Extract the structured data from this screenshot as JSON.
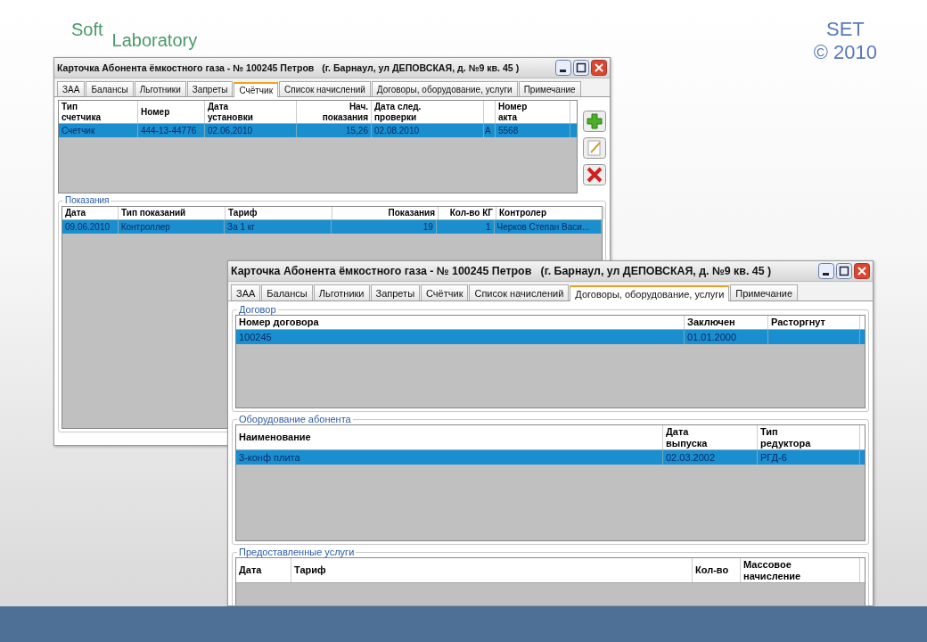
{
  "slide": {
    "brand": [
      "Soft",
      "Laboratory"
    ],
    "corner": [
      "SET",
      "© 2010"
    ]
  },
  "windows": [
    {
      "title": "Карточка Абонента ёмкостного газа - № 100245 Петров   (г. Барнаул, ул ДЕПОВСКАЯ, д. №9 кв. 45 )",
      "tabs": [
        {
          "label": "ЗАА",
          "selected": false
        },
        {
          "label": "Балансы",
          "selected": false
        },
        {
          "label": "Льготники",
          "selected": false
        },
        {
          "label": "Запреты",
          "selected": false
        },
        {
          "label": "Счётчик",
          "selected": true
        },
        {
          "label": "Список начислений",
          "selected": false
        },
        {
          "label": "Договоры, оборудование, услуги",
          "selected": false
        },
        {
          "label": "Примечание",
          "selected": false
        }
      ],
      "groups": [
        {
          "columns": [
            {
              "label": "Тип\nсчетчика",
              "kind": "text"
            },
            {
              "label": "Номер",
              "kind": "text"
            },
            {
              "label": "Дата\nустановки",
              "kind": "text"
            },
            {
              "label": "Нач.\nпоказания",
              "kind": "number"
            },
            {
              "label": "Дата след.\nпроверки",
              "kind": "text"
            },
            {
              "kind": "text"
            },
            {
              "label": "Номер\nакта",
              "kind": "text"
            }
          ],
          "rows": [
            {
              "selected": true,
              "cells": [
                "Счетчик",
                "444-13-44776",
                "02.06.2010",
                "15,26",
                "02.08.2010",
                "А",
                "5568"
              ]
            }
          ],
          "side_buttons": [
            {
              "kind": "add"
            },
            {
              "kind": "edit"
            },
            {
              "kind": "delete"
            }
          ]
        },
        {
          "legend": "Показания",
          "columns": [
            {
              "label": "Дата",
              "kind": "text"
            },
            {
              "label": "Тип показаний",
              "kind": "text"
            },
            {
              "label": "Тариф",
              "kind": "text"
            },
            {
              "label": "Показания",
              "kind": "number"
            },
            {
              "label": "Кол-во КГ",
              "kind": "number"
            },
            {
              "label": "Контролер",
              "kind": "text"
            }
          ],
          "rows": [
            {
              "selected": true,
              "cells": [
                "09.06.2010",
                "Контроллер",
                "За 1 кг",
                "19",
                "1",
                "Черков Степан Васи..."
              ]
            }
          ]
        }
      ]
    },
    {
      "title": "Карточка Абонента ёмкостного газа - № 100245 Петров   (г. Барнаул, ул ДЕПОВСКАЯ, д. №9 кв. 45 )",
      "tabs": [
        {
          "label": "ЗАА",
          "selected": false
        },
        {
          "label": "Балансы",
          "selected": false
        },
        {
          "label": "Льготники",
          "selected": false
        },
        {
          "label": "Запреты",
          "selected": false
        },
        {
          "label": "Счётчик",
          "selected": false
        },
        {
          "label": "Список начислений",
          "selected": false
        },
        {
          "label": "Договоры, оборудование, услуги",
          "selected": true
        },
        {
          "label": "Примечание",
          "selected": false
        }
      ],
      "groups": [
        {
          "legend": "Договор",
          "columns": [
            {
              "label": "Номер договора",
              "kind": "text"
            },
            {
              "label": "Заключен",
              "kind": "text"
            },
            {
              "label": "Расторгнут",
              "kind": "text"
            }
          ],
          "rows": [
            {
              "selected": true,
              "cells": [
                "100245",
                "01.01.2000"
              ]
            }
          ]
        },
        {
          "legend": "Оборудование абонента",
          "columns": [
            {
              "label": "Наименование",
              "kind": "text"
            },
            {
              "label": "Дата\nвыпуска",
              "kind": "text"
            },
            {
              "label": "Тип\nредуктора",
              "kind": "text"
            }
          ],
          "rows": [
            {
              "selected": true,
              "cells": [
                "3-конф плита",
                "02.03.2002",
                "РГД-6"
              ]
            }
          ]
        },
        {
          "legend": "Предоставленные услуги",
          "columns": [
            {
              "label": "Дата",
              "kind": "text"
            },
            {
              "label": "Тариф",
              "kind": "text"
            },
            {
              "label": "Кол-во",
              "kind": "text"
            },
            {
              "label": "Массовое\nначисление",
              "kind": "text"
            }
          ]
        }
      ]
    }
  ]
}
